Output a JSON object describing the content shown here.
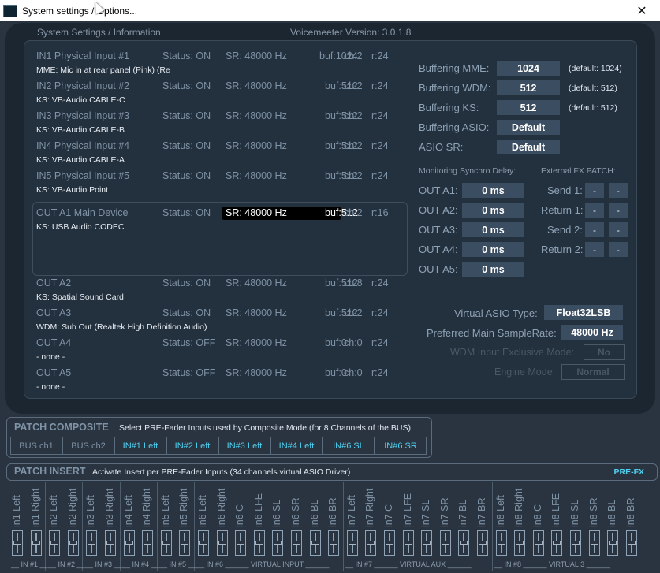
{
  "window": {
    "title": "System settings / Options...",
    "close_label": "✕"
  },
  "panel": {
    "header_left": "System Settings / Information",
    "header_version": "Voicemeeter Version: 3.0.1.8"
  },
  "devices": [
    {
      "name": "IN1 Physical Input #1",
      "status": "Status: ON",
      "sr": "SR: 48000 Hz",
      "buf": "buf:1024",
      "ch": "ch:2",
      "r": "r:24",
      "sub": "MME: Mic in at rear panel (Pink) (Re"
    },
    {
      "name": "IN2 Physical Input #2",
      "status": "Status: ON",
      "sr": "SR: 48000 Hz",
      "buf": "buf:512",
      "ch": "ch:2",
      "r": "r:24",
      "sub": "KS: VB-Audio CABLE-C"
    },
    {
      "name": "IN3 Physical Input #3",
      "status": "Status: ON",
      "sr": "SR: 48000 Hz",
      "buf": "buf:512",
      "ch": "ch:2",
      "r": "r:24",
      "sub": "KS: VB-Audio CABLE-B"
    },
    {
      "name": "IN4 Physical Input #4",
      "status": "Status: ON",
      "sr": "SR: 48000 Hz",
      "buf": "buf:512",
      "ch": "ch:2",
      "r": "r:24",
      "sub": "KS: VB-Audio CABLE-A"
    },
    {
      "name": "IN5 Physical Input #5",
      "status": "Status: ON",
      "sr": "SR: 48000 Hz",
      "buf": "buf:512",
      "ch": "ch:2",
      "r": "r:24",
      "sub": "KS: VB-Audio Point"
    },
    {
      "name": "OUT A1 Main Device",
      "status": "Status: ON",
      "sr": "SR: 48000 Hz",
      "buf": "buf:512",
      "ch": "ch:2",
      "r": "r:16",
      "sub": "KS: USB Audio CODEC"
    },
    {
      "name": "OUT A2",
      "status": "Status: ON",
      "sr": "SR: 48000 Hz",
      "buf": "buf:512",
      "ch": "ch:8",
      "r": "r:24",
      "sub": "KS: Spatial Sound Card"
    },
    {
      "name": "OUT A3",
      "status": "Status: ON",
      "sr": "SR: 48000 Hz",
      "buf": "buf:512",
      "ch": "ch:2",
      "r": "r:24",
      "sub": "WDM: Sub Out (Realtek High Definition Audio)"
    },
    {
      "name": "OUT A4",
      "status": "Status: OFF",
      "sr": "SR: 48000 Hz",
      "buf": "buf:0",
      "ch": "ch:0",
      "r": "r:24",
      "sub": "- none -"
    },
    {
      "name": "OUT A5",
      "status": "Status: OFF",
      "sr": "SR: 48000 Hz",
      "buf": "buf:0",
      "ch": "ch:0",
      "r": "r:24",
      "sub": "- none -"
    }
  ],
  "buffering": [
    {
      "label": "Buffering MME:",
      "value": "1024",
      "default": "(default: 1024)"
    },
    {
      "label": "Buffering WDM:",
      "value": "512",
      "default": "(default: 512)"
    },
    {
      "label": "Buffering KS:",
      "value": "512",
      "default": "(default: 512)"
    },
    {
      "label": "Buffering ASIO:",
      "value": "Default",
      "default": ""
    },
    {
      "label": "ASIO SR:",
      "value": "Default",
      "default": ""
    }
  ],
  "monitoring": {
    "header": "Monitoring Synchro Delay:",
    "items": [
      {
        "label": "OUT A1:",
        "value": "0 ms"
      },
      {
        "label": "OUT A2:",
        "value": "0 ms"
      },
      {
        "label": "OUT A3:",
        "value": "0 ms"
      },
      {
        "label": "OUT A4:",
        "value": "0 ms"
      },
      {
        "label": "OUT A5:",
        "value": "0 ms"
      }
    ]
  },
  "external_fx": {
    "header": "External FX PATCH:",
    "items": [
      {
        "label": "Send 1:",
        "a": "-",
        "b": "-"
      },
      {
        "label": "Return 1:",
        "a": "-",
        "b": "-"
      },
      {
        "label": "Send 2:",
        "a": "-",
        "b": "-"
      },
      {
        "label": "Return 2:",
        "a": "-",
        "b": "-"
      }
    ]
  },
  "engine": {
    "virtual_asio_label": "Virtual ASIO Type:",
    "virtual_asio_value": "Float32LSB",
    "samplerate_label": "Preferred Main SampleRate:",
    "samplerate_value": "48000 Hz",
    "wdm_exclusive_label": "WDM Input Exclusive Mode:",
    "wdm_exclusive_value": "No",
    "engine_mode_label": "Engine Mode:",
    "engine_mode_value": "Normal"
  },
  "patch_composite": {
    "title": "PATCH COMPOSITE",
    "description": "Select PRE-Fader Inputs used by Composite Mode (for 8 Channels of the BUS)",
    "buttons": [
      "BUS ch1",
      "BUS ch2",
      "IN#1 Left",
      "IN#2 Left",
      "IN#3 Left",
      "IN#4 Left",
      "IN#6 SL",
      "IN#6 SR"
    ]
  },
  "patch_insert": {
    "title": "PATCH INSERT",
    "description": "Activate Insert per PRE-Fader Inputs (34 channels virtual ASIO Driver)",
    "prefx": "PRE-FX",
    "channels": [
      "in1 Left",
      "in1 Right",
      "in2 Left",
      "in2 Right",
      "in3 Left",
      "in3 Right",
      "in4 Left",
      "in4 Right",
      "in5 Left",
      "in5 Right",
      "in6 Left",
      "in6 Right",
      "in6 C",
      "in6 LFE",
      "in6 SL",
      "in6 SR",
      "in6 BL",
      "in6 BR",
      "in7 Left",
      "in7 Right",
      "in7 C",
      "in7 LFE",
      "in7 SL",
      "in7 SR",
      "in7 BL",
      "in7 BR",
      "in8 Left",
      "in8 Right",
      "in8 C",
      "in8 LFE",
      "in8 SL",
      "in8 SR",
      "in8 BL",
      "in8 BR"
    ],
    "groups": [
      "__ IN #1 __",
      "__ IN #2 __",
      "__ IN #3 __",
      "__ IN #4 __",
      "__ IN #5 __",
      "__ IN #6 ______ VIRTUAL INPUT ______",
      "__ IN #7 ______ VIRTUAL AUX ______",
      "__ IN #8 ______ VIRTUAL 3 ______"
    ]
  },
  "colors": {
    "accent_cyan": "#4fd0f0",
    "value_box": "#3b4d60",
    "panel_bg": "#1c2631"
  }
}
